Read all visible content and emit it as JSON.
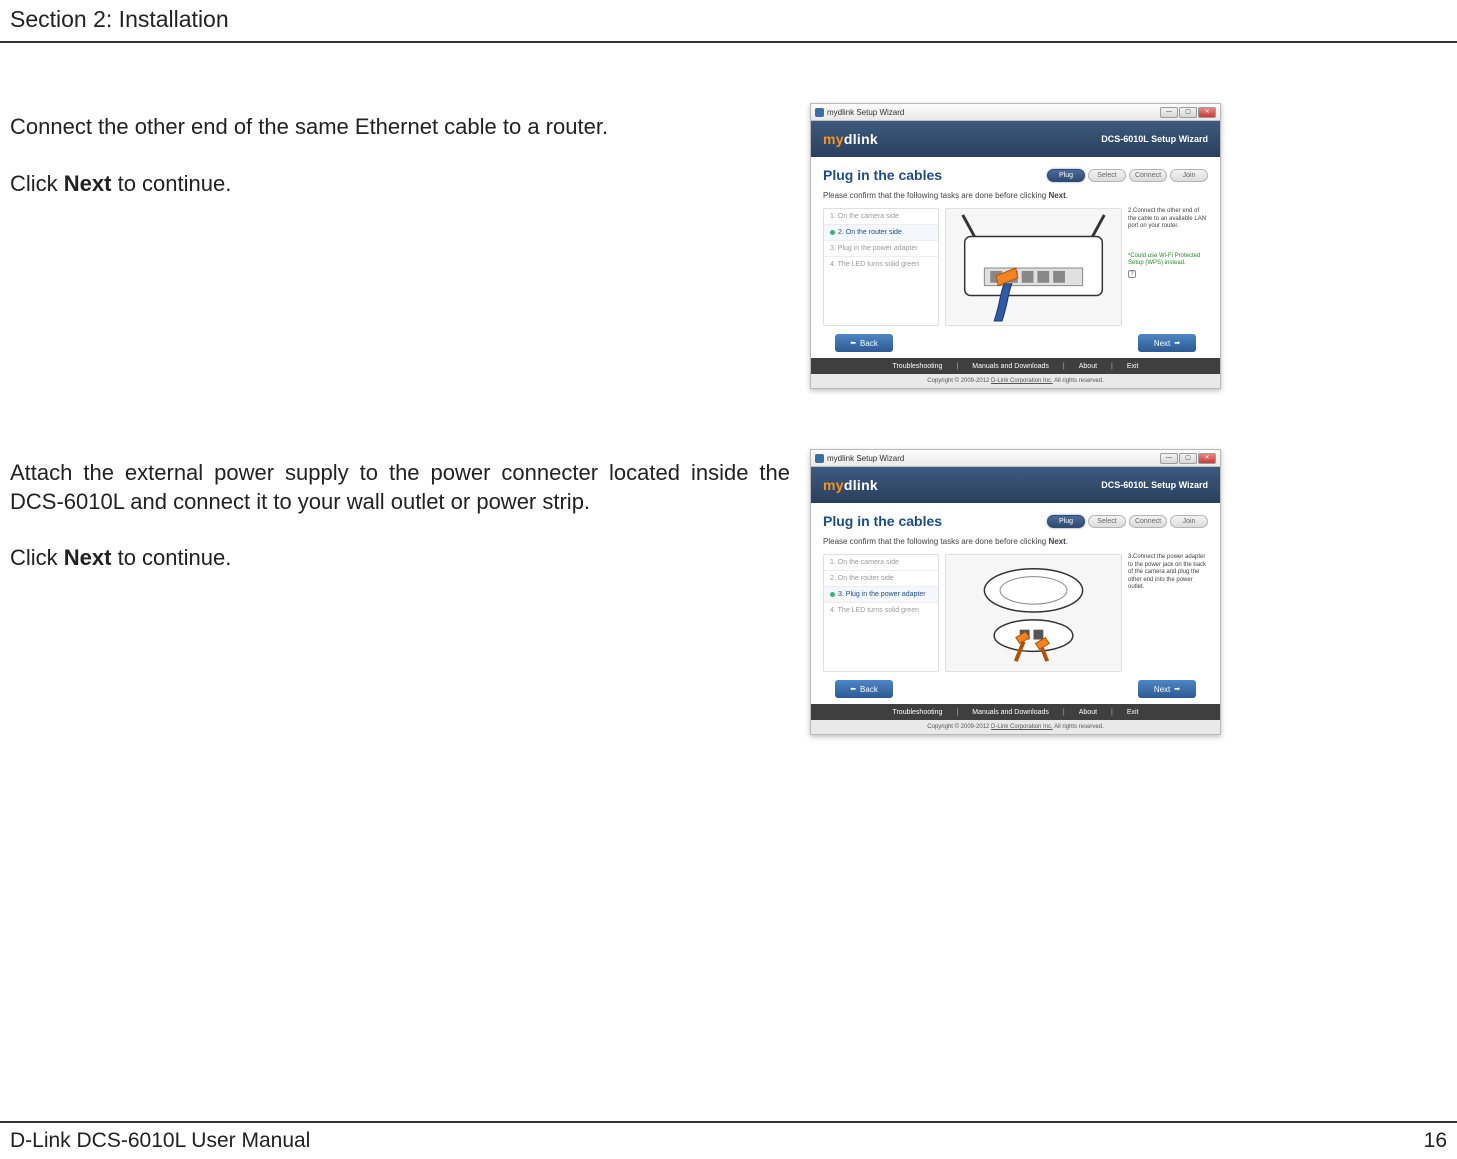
{
  "header": {
    "section_title": "Section 2: Installation"
  },
  "footer": {
    "manual_title": "D-Link DCS-6010L User Manual",
    "page_number": "16"
  },
  "blocks": [
    {
      "para1": "Connect the other end of the same Ethernet cable to a router.",
      "para2_pre": "Click ",
      "para2_bold": "Next",
      "para2_post": " to continue."
    },
    {
      "para1": "Attach the external power supply to the power connecter located inside the DCS-6010L and connect it to your wall outlet or power strip.",
      "para2_pre": "Click ",
      "para2_bold": "Next",
      "para2_post": " to continue."
    }
  ],
  "wizard_common": {
    "titlebar_text": "mydlink Setup Wizard",
    "win_min": "—",
    "win_max": "▢",
    "win_close": "✕",
    "logo_my": "my",
    "logo_dlink": "dlink",
    "setup_name": "DCS-6010L Setup Wizard",
    "heading": "Plug in the cables",
    "pills": [
      "Plug",
      "Select",
      "Connect",
      "Join"
    ],
    "subtext_pre": "Please confirm that the following tasks are done before clicking ",
    "subtext_bold": "Next",
    "subtext_post": ".",
    "tasks": [
      "1. On the camera side",
      "2. On the router side",
      "3. Plug in the power adapter",
      "4. The LED turns solid green"
    ],
    "back_label": "Back",
    "next_label": "Next",
    "footer_links": [
      "Troubleshooting",
      "Manuals and Downloads",
      "About",
      "Exit"
    ],
    "copyright_pre": "Copyright © 2009-2012 ",
    "copyright_link": "D-Link Corporation Inc.",
    "copyright_post": " All rights reserved."
  },
  "wizard1": {
    "active_task_index": 1,
    "hint": "2.Connect the other end of the cable to an available LAN port on your router.",
    "wps_note": "*Could use Wi-Fi Protected Setup (WPS) instead.",
    "qmark": "?"
  },
  "wizard2": {
    "active_task_index": 2,
    "hint": "3.Connect the power adapter to the power jack on the back of the camera and plug the other end into the power outlet."
  }
}
